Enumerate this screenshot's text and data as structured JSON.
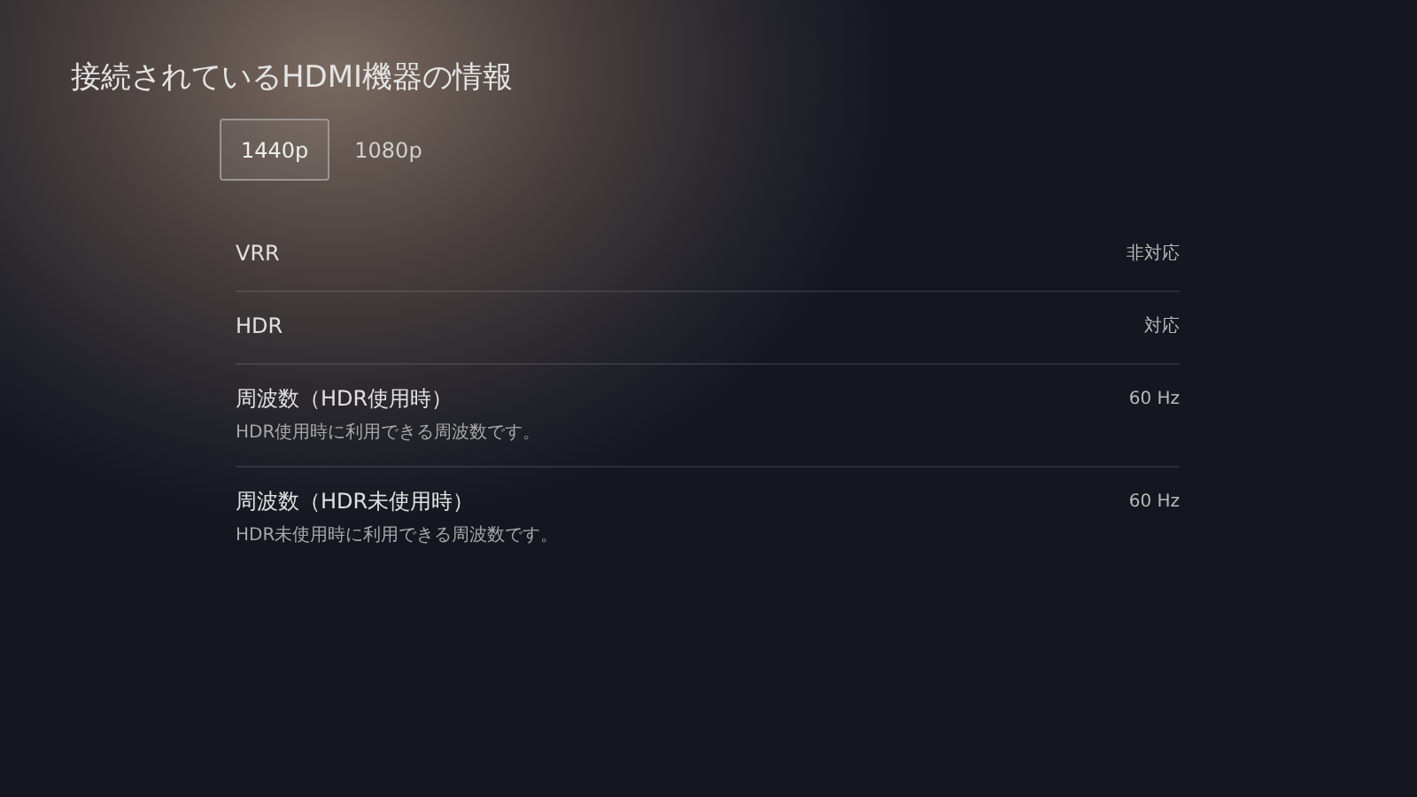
{
  "title": "接続されているHDMI機器の情報",
  "tabs": [
    {
      "label": "1440p",
      "selected": true
    },
    {
      "label": "1080p",
      "selected": false
    }
  ],
  "rows": [
    {
      "label": "VRR",
      "value": "非対応"
    },
    {
      "label": "HDR",
      "value": "対応"
    },
    {
      "label": "周波数（HDR使用時）",
      "value": "60 Hz",
      "description": "HDR使用時に利用できる周波数です。"
    },
    {
      "label": "周波数（HDR未使用時）",
      "value": "60 Hz",
      "description": "HDR未使用時に利用できる周波数です。"
    }
  ]
}
